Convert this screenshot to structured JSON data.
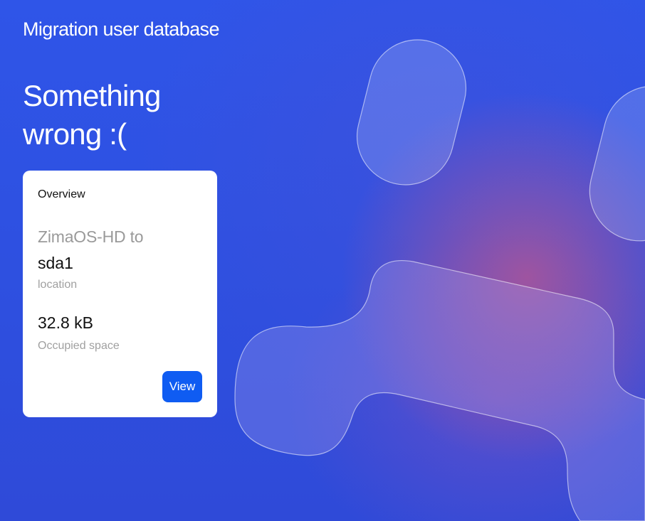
{
  "app": {
    "title": "Migration user database"
  },
  "status": {
    "headline": "Something wrong :("
  },
  "overview_card": {
    "title": "Overview",
    "source_path": "ZimaOS-HD to",
    "target_path": "sda1",
    "location_label": "location",
    "occupied_space_value": "32.8 kB",
    "occupied_space_label": "Occupied space",
    "view_button_label": "View"
  },
  "colors": {
    "background": "#2f4fe0",
    "accent": "#0f5cf2",
    "card": "#ffffff",
    "muted_text": "#a0a0a0"
  }
}
